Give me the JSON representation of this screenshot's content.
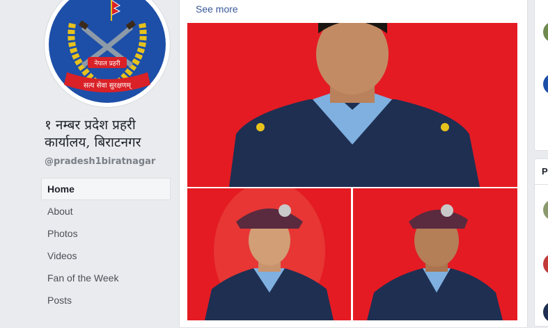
{
  "page": {
    "name": "१ नम्बर प्रदेश प्रहरी कार्यालय, बिराटनगर",
    "handle": "@pradesh1biratnagar",
    "logo_text": {
      "top": "नेपाल प्रहरी",
      "bottom": "सत्य सेवा सुरक्षणम्"
    }
  },
  "nav": {
    "items": [
      {
        "label": "Home",
        "active": true
      },
      {
        "label": "About"
      },
      {
        "label": "Photos"
      },
      {
        "label": "Videos"
      },
      {
        "label": "Fan of the Week"
      },
      {
        "label": "Posts"
      }
    ]
  },
  "post": {
    "see_more": "See more"
  },
  "right_rail": {
    "section_head": "Pa"
  },
  "colors": {
    "photo_background": "#e41b23",
    "link": "#385898",
    "page_background": "#e9ebee",
    "uniform_navy": "#1e2f52",
    "shirt_blue": "#7fb0df"
  },
  "icons": [
    "police-logo-icon",
    "profile-photo-icon"
  ]
}
